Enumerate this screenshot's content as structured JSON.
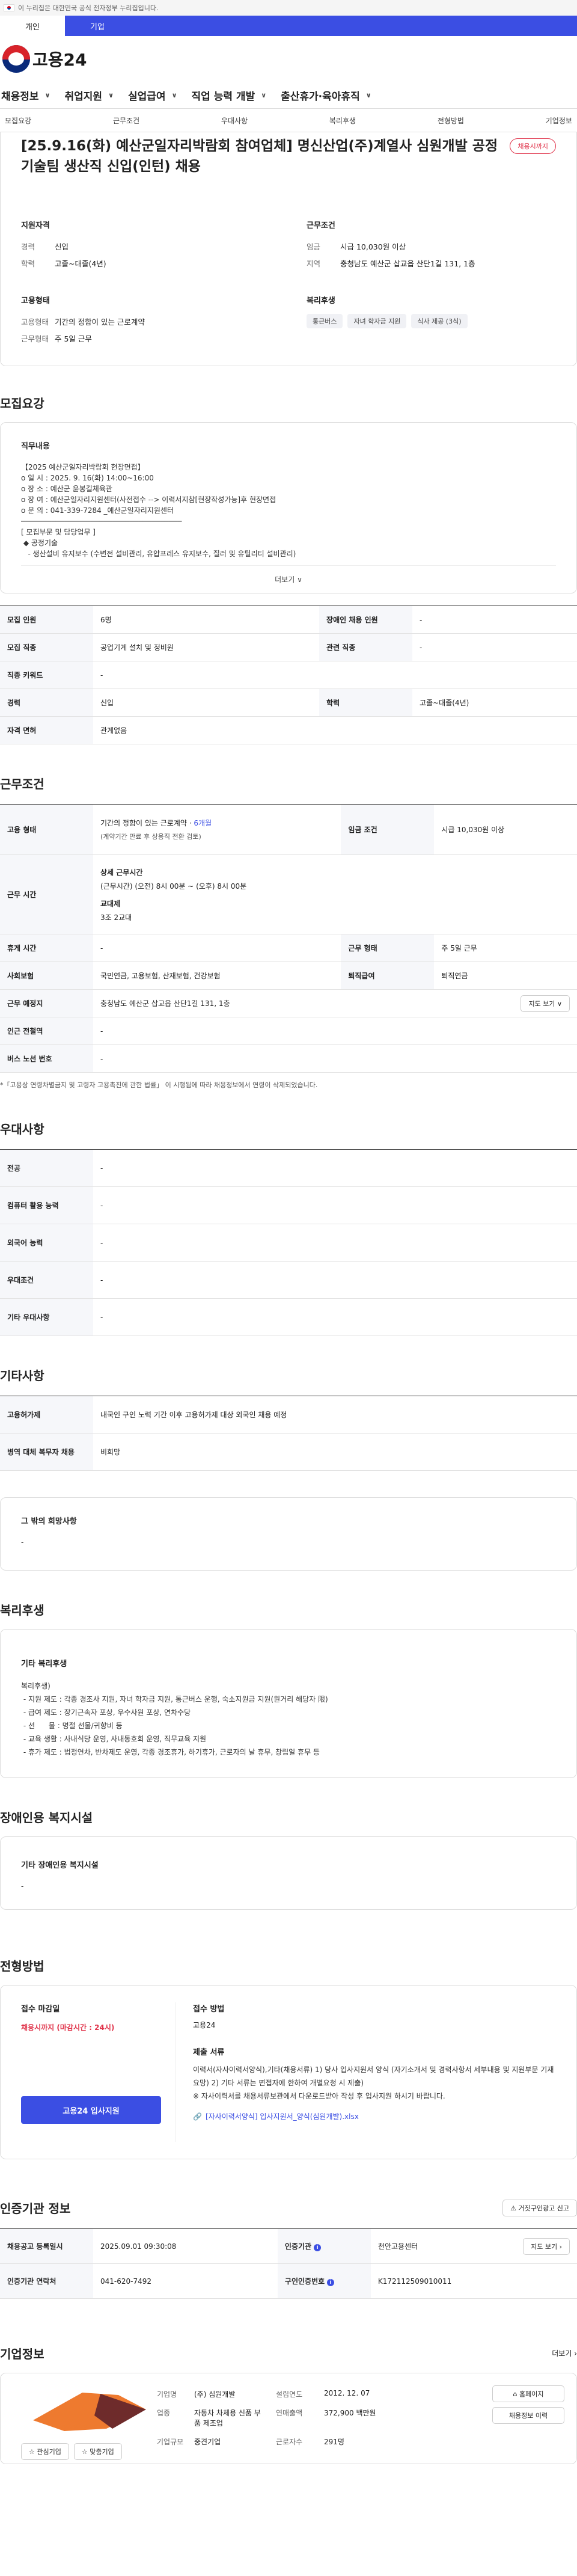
{
  "gov_banner": "이 누리집은 대한민국 공식 전자정부 누리집입니다.",
  "top_tabs": [
    "개인",
    "기업"
  ],
  "logo": "고용24",
  "gnb": [
    "채용정보",
    "취업지원",
    "실업급여",
    "직업 능력 개발",
    "출산휴가·육아휴직"
  ],
  "subnav": [
    "모집요강",
    "근무조건",
    "우대사항",
    "복리후생",
    "전형방법",
    "기업정보"
  ],
  "job_title": "[25.9.16(화) 예산군일자리박람회 참여업체] 명신산업(주)계열사 심원개발 공정기술팀 생산직 신입(인턴) 채용",
  "status_badge": "채용시까지",
  "summary": {
    "qual_h": "지원자격",
    "exp_k": "경력",
    "exp_v": "신입",
    "edu_k": "학력",
    "edu_v": "고졸~대졸(4년)",
    "type_h": "고용형태",
    "emp_k": "고용형태",
    "emp_v": "기간의 정함이 있는 근로계약",
    "work_k": "근무형태",
    "work_v": "주 5일 근무",
    "cond_h": "근무조건",
    "wage_k": "임금",
    "wage_v": "시급 10,030원 이상",
    "region_k": "지역",
    "region_v": "충청남도 예산군 삽교읍 산단1길 131, 1층",
    "welfare_h": "복리후생",
    "welfare_tags": [
      "통근버스",
      "자녀 학자금 지원",
      "식사 제공 (3식)"
    ]
  },
  "recruit": {
    "title": "모집요강",
    "duty_h": "직무내용",
    "duty_text": "【2025 예산군일자리박람회 현장면접】\no 일 시 : 2025. 9. 16(화) 14:00~16:00\no 장 소 : 예산군 윤봉길체육관\no 장 여 : 예산군일자리지원센터(사전접수 --> 이력서지참[현장작성가능]후 현장면접\no 문 의 : 041-339-7284 _예산군일자리지원센터\n─────────────────────────────────────\n[ 모집부문 및 담당업무 ]\n ◆ 공정기술\n   - 생산설비 유지보수 (수변전 설비관리, 유압프레스 유지보수, 질러 및 유틸리티 설비관리)",
    "more": "더보기",
    "rows": [
      [
        "모집 인원",
        "6명",
        "장애인 채용 인원",
        "-"
      ],
      [
        "모집 직종",
        "공업기계 설치 및 정비원",
        "관련 직종",
        "-"
      ],
      [
        "직종 키워드",
        "-",
        "",
        ""
      ],
      [
        "경력",
        "신입",
        "학력",
        "고졸~대졸(4년)"
      ],
      [
        "자격 면허",
        "관계없음",
        "",
        ""
      ]
    ]
  },
  "conditions": {
    "title": "근무조건",
    "emp_k": "고용 형태",
    "emp_v1": "기간의 정함이 있는 근로계약 ·",
    "emp_v1b": "6개월",
    "emp_v2": "(계약기간 만료 후 상용직 전환 검토)",
    "wage_k": "임금 조건",
    "wage_v": "시급 10,030원 이상",
    "hours_k": "근무 시간",
    "hours_h1": "상세 근무시간",
    "hours_v1": "(근무시간) (오전) 8시 00분 ~ (오후) 8시 00분",
    "hours_h2": "교대제",
    "hours_v2": "3조 2교대",
    "rest_k": "휴게 시간",
    "rest_v": "-",
    "form_k": "근무 형태",
    "form_v": "주 5일 근무",
    "ins_k": "사회보험",
    "ins_v": "국민연금, 고용보험, 산재보험, 건강보험",
    "sev_k": "퇴직급여",
    "sev_v": "퇴직연금",
    "place_k": "근무 예정지",
    "place_v": "충청남도 예산군 삽교읍 산단1길 131, 1층",
    "map_btn": "지도 보기",
    "station_k": "인근 전철역",
    "station_v": "-",
    "bus_k": "버스 노선 번호",
    "bus_v": "-",
    "note": "*「고용상 연령차별금지 및 고령자 고용촉진에 관한 법률」 이 시행됨에 따라 채용정보에서 연령이 삭제되었습니다."
  },
  "preferred": {
    "title": "우대사항",
    "rows": [
      [
        "전공",
        "-"
      ],
      [
        "컴퓨터 활용 능력",
        "-"
      ],
      [
        "외국어 능력",
        "-"
      ],
      [
        "우대조건",
        "-"
      ],
      [
        "기타 우대사항",
        "-"
      ]
    ]
  },
  "other": {
    "title": "기타사항",
    "rows": [
      [
        "고용허가제",
        "내국인 구인 노력 기간 이후 고용허가제 대상 외국인 채용 예정"
      ],
      [
        "병역 대체 복무자 채용",
        "비희망"
      ]
    ],
    "wish_h": "그 밖의 희망사항",
    "wish_v": "-"
  },
  "welfare": {
    "title": "복리후생",
    "box_h": "기타 복리후생",
    "text": "복리후생)\n - 지원 제도 : 각종 경조사 지원, 자녀 학자금 지원, 통근버스 운행, 숙소지원금 지원(원거리 해당자 限)\n - 급여 제도 : 장기근속자 포상, 우수사원 포상, 연차수당\n - 선      물 : 명절 선물/귀향비 등\n - 교육 생활 : 사내식당 운영, 사내동호회 운영, 직무교육 지원\n - 휴가 제도 : 법정연차, 반차제도 운영, 각종 경조휴가, 하기휴가, 근로자의 날 휴무, 창립일 휴무 등"
  },
  "disability": {
    "title": "장애인용 복지시설",
    "box_h": "기타 장애인용 복지시설",
    "box_v": "-"
  },
  "process": {
    "title": "전형방법",
    "deadline_h": "접수 마감일",
    "deadline_v": "채용시까지 (마감시간 : 24시)",
    "apply_btn": "고용24 입사지원",
    "method_h": "접수 방법",
    "method_v": "고용24",
    "docs_h": "제출 서류",
    "docs_v": "이력서(자사이력서양식),기타(채용서류) 1) 당사 입사지원서 양식 (자기소개서 및 경력사항서 세부내용 및 지원부문 기재 요망) 2) 기타 서류는 면접자에 한하여 개별요청 시 제출)\n※ 자사이력서를 채용서류보관에서 다운로드받아 작성 후 입사지원 하시기 바랍니다.",
    "file": "[자사이력서양식] 입사지원서_양식(심원개발).xlsx"
  },
  "agency": {
    "title": "인증기관 정보",
    "report_btn": "거짓구인광고 신고",
    "reg_k": "채용공고 등록일시",
    "reg_v": "2025.09.01 09:30:08",
    "org_k": "인증기관",
    "org_v": "천안고용센터",
    "contact_k": "인증기관 연락처",
    "contact_v": "041-620-7492",
    "num_k": "구인인증번호",
    "num_v": "K172112509010011",
    "map_btn": "지도 보기"
  },
  "company": {
    "title": "기업정보",
    "more": "더보기",
    "fav_btn": "관심기업",
    "follow_btn": "맞춤기업",
    "name_k": "기업명",
    "name_v": "(주) 심원개발",
    "ind_k": "업종",
    "ind_v": "자동차 차체용 신품 부품 제조업",
    "size_k": "기업규모",
    "size_v": "중견기업",
    "est_k": "설립연도",
    "est_v": "2012. 12. 07",
    "sales_k": "연매출액",
    "sales_v": "372,900 백만원",
    "emp_k": "근로자수",
    "emp_v": "291명",
    "home_btn": "홈페이지",
    "list_btn": "채용정보 이력"
  }
}
